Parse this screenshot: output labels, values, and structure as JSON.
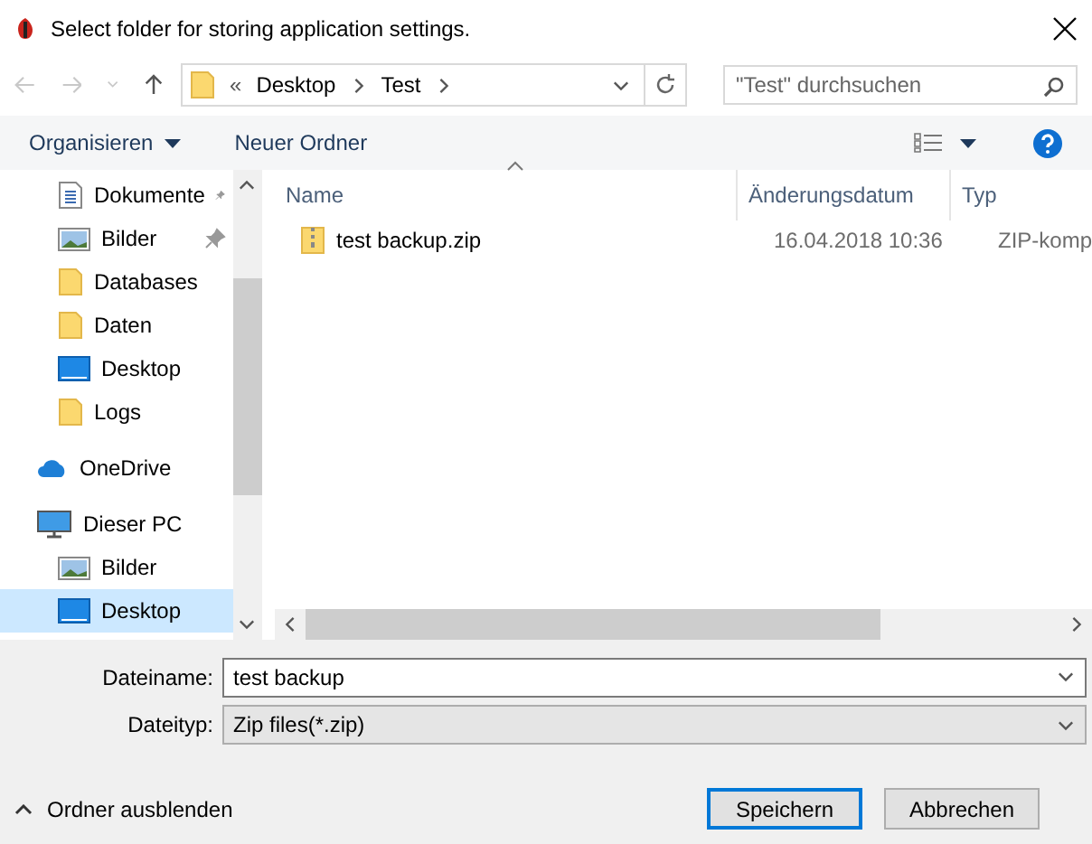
{
  "window": {
    "title": "Select folder for storing application settings."
  },
  "address": {
    "overflow": "«",
    "crumbs": [
      "Desktop",
      "Test"
    ]
  },
  "search": {
    "placeholder": "\"Test\" durchsuchen"
  },
  "toolbar": {
    "organize": "Organisieren",
    "new_folder": "Neuer Ordner"
  },
  "nav": {
    "quick_access": [
      {
        "label": "Dokumente",
        "kind": "document",
        "pinned": true,
        "selected": false
      },
      {
        "label": "Bilder",
        "kind": "picture",
        "pinned": true,
        "selected": false
      },
      {
        "label": "Databases",
        "kind": "folder",
        "pinned": false,
        "selected": false
      },
      {
        "label": "Daten",
        "kind": "folder",
        "pinned": false,
        "selected": false
      },
      {
        "label": "Desktop",
        "kind": "desktop",
        "pinned": false,
        "selected": false
      },
      {
        "label": "Logs",
        "kind": "folder",
        "pinned": false,
        "selected": false
      }
    ],
    "items": [
      {
        "label": "OneDrive",
        "kind": "cloud",
        "selected": false
      },
      {
        "label": "Dieser PC",
        "kind": "pc",
        "selected": false,
        "children": [
          {
            "label": "Bilder",
            "kind": "picture",
            "selected": false
          },
          {
            "label": "Desktop",
            "kind": "desktop",
            "selected": true
          }
        ]
      }
    ]
  },
  "table": {
    "columns": [
      "Name",
      "Änderungsdatum",
      "Typ"
    ],
    "rows": [
      {
        "name": "test backup.zip",
        "date": "16.04.2018 10:36",
        "type": "ZIP-komp"
      }
    ]
  },
  "filename": {
    "label": "Dateiname:",
    "value": "test backup"
  },
  "filetype": {
    "label": "Dateityp:",
    "value": "Zip files(*.zip)"
  },
  "hide_folders": "Ordner ausblenden",
  "buttons": [
    {
      "label": "Speichern",
      "default": true
    },
    {
      "label": "Abbrechen",
      "default": false
    }
  ]
}
